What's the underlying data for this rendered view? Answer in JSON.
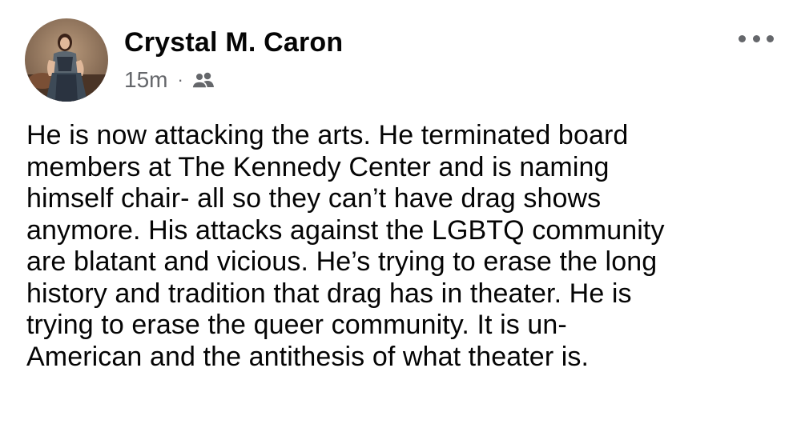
{
  "post": {
    "author_name": "Crystal M. Caron",
    "timestamp": "15m",
    "separator": "·",
    "audience_icon": "friends-icon",
    "more_icon": "more-options-icon",
    "body_lines": [
      "He is now attacking the arts. He terminated board",
      "members at The Kennedy Center and is naming",
      "himself chair- all so they can’t have drag shows",
      "anymore. His attacks against the LGBTQ community",
      "are blatant and vicious. He’s trying to erase the long",
      "history and tradition that drag has in theater. He is",
      "trying to erase the queer community. It is un-",
      "American and the antithesis of what theater is."
    ]
  },
  "colors": {
    "text": "#050505",
    "secondary": "#65676b",
    "background": "#ffffff"
  }
}
